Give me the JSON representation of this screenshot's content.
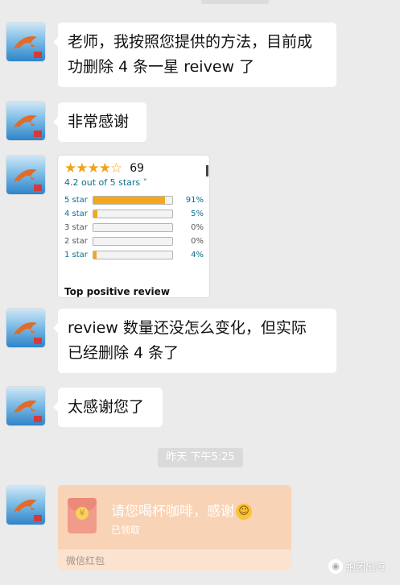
{
  "messages": {
    "m1": {
      "line1": "老师，我按照您提供的方法，目前成",
      "line2": "功删除 4 条一星 reivew 了"
    },
    "m2": {
      "text": "非常感谢"
    },
    "m4": {
      "line1": "review 数量还没怎么变化，但实际",
      "line2": "已经删除 4 条了"
    },
    "m5": {
      "text": "太感谢您了"
    }
  },
  "review_card": {
    "stars_display": "★★★★☆",
    "rating_count": "69",
    "out_of": "4.2 out of 5 stars ˅",
    "histogram": [
      {
        "label": "5 star",
        "pct": "91%",
        "fill": 0.91
      },
      {
        "label": "4 star",
        "pct": "5%",
        "fill": 0.05
      },
      {
        "label": "3 star",
        "pct": "0%",
        "fill": 0.0
      },
      {
        "label": "2 star",
        "pct": "0%",
        "fill": 0.0
      },
      {
        "label": "1 star",
        "pct": "4%",
        "fill": 0.04
      }
    ],
    "top_positive": "Top positive review"
  },
  "timestamp": "昨天 下午5:25",
  "red_packet": {
    "title": "请您喝杯咖啡，感谢",
    "status": "已领取",
    "footer": "微信红包",
    "coin_symbol": "¥",
    "emoji_icon": "smiley-icon"
  },
  "watermark": {
    "text": "抱团出海"
  },
  "colors": {
    "background": "#ebebeb",
    "bubble": "#ffffff",
    "star": "#f0a31a",
    "link": "#0a6f8e",
    "packet": "#fbe3cf"
  }
}
